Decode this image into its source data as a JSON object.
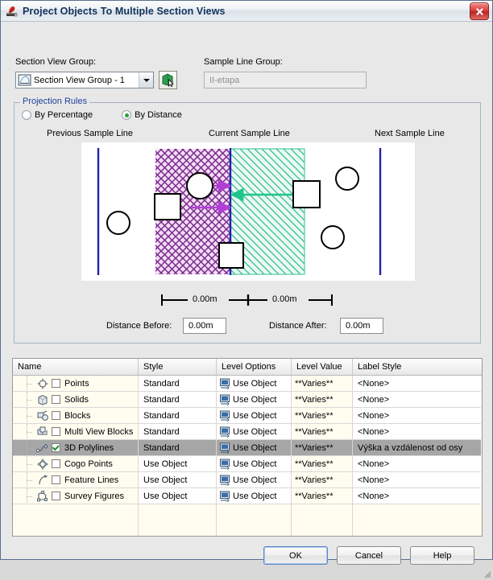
{
  "window": {
    "title": "Project Objects To Multiple Section Views",
    "title_icon": "autocad-civil-app-icon",
    "close_label": "×"
  },
  "top": {
    "section_view_group_label": "Section View Group:",
    "section_view_group_value": "Section View Group - 1",
    "section_view_group_icon": "section-view-group-icon",
    "pick_button_icon": "pick-in-drawing-icon",
    "sample_line_group_label": "Sample Line Group:",
    "sample_line_group_value": "II-etapa"
  },
  "projection": {
    "group_label": "Projection Rules",
    "options": [
      {
        "label": "By Percentage",
        "selected": false
      },
      {
        "label": "By Distance",
        "selected": true
      }
    ],
    "diagram_labels": {
      "previous": "Previous Sample Line",
      "current": "Current Sample Line",
      "next": "Next Sample Line"
    },
    "dimension_before": "0.00m",
    "dimension_after": "0.00m",
    "distance_before_label": "Distance Before:",
    "distance_before_value": "0.00m",
    "distance_after_label": "Distance After:",
    "distance_after_value": "0.00m",
    "colors": {
      "before_hatch": "#7a2a8c",
      "before_fill": "#f2dcf5",
      "after_hatch": "#2fbf8f",
      "after_fill": "#e9f9f1",
      "sample_line": "#2222aa",
      "arrow_before": "#b13fd6",
      "arrow_after": "#1fc58a"
    }
  },
  "table": {
    "columns": [
      "Name",
      "Style",
      "Level Options",
      "Level Value",
      "Label Style"
    ],
    "rows": [
      {
        "icon": "points-icon",
        "name": "Points",
        "checked": false,
        "style": "Standard",
        "level_options": "Use Object",
        "level_value": "**Varies**",
        "label_style": "<None>",
        "selected": false
      },
      {
        "icon": "solids-icon",
        "name": "Solids",
        "checked": false,
        "style": "Standard",
        "level_options": "Use Object",
        "level_value": "**Varies**",
        "label_style": "<None>",
        "selected": false
      },
      {
        "icon": "blocks-icon",
        "name": "Blocks",
        "checked": false,
        "style": "Standard",
        "level_options": "Use Object",
        "level_value": "**Varies**",
        "label_style": "<None>",
        "selected": false
      },
      {
        "icon": "multi-view-blocks-icon",
        "name": "Multi View Blocks",
        "checked": false,
        "style": "Standard",
        "level_options": "Use Object",
        "level_value": "**Varies**",
        "label_style": "<None>",
        "selected": false
      },
      {
        "icon": "polylines-3d-icon",
        "name": "3D Polylines",
        "checked": true,
        "style": "Standard",
        "level_options": "Use Object",
        "level_value": "**Varies**",
        "label_style": "Výška a vzdálenost od osy",
        "selected": true
      },
      {
        "icon": "cogo-points-icon",
        "name": "Cogo Points",
        "checked": false,
        "style": "Use Object",
        "level_options": "Use Object",
        "level_value": "**Varies**",
        "label_style": "<None>",
        "selected": false
      },
      {
        "icon": "feature-lines-icon",
        "name": "Feature Lines",
        "checked": false,
        "style": "Use Object",
        "level_options": "Use Object",
        "level_value": "**Varies**",
        "label_style": "<None>",
        "selected": false
      },
      {
        "icon": "survey-figures-icon",
        "name": "Survey Figures",
        "checked": false,
        "style": "Use Object",
        "level_options": "Use Object",
        "level_value": "**Varies**",
        "label_style": "<None>",
        "selected": false
      }
    ]
  },
  "footer": {
    "ok": "OK",
    "cancel": "Cancel",
    "help": "Help"
  }
}
